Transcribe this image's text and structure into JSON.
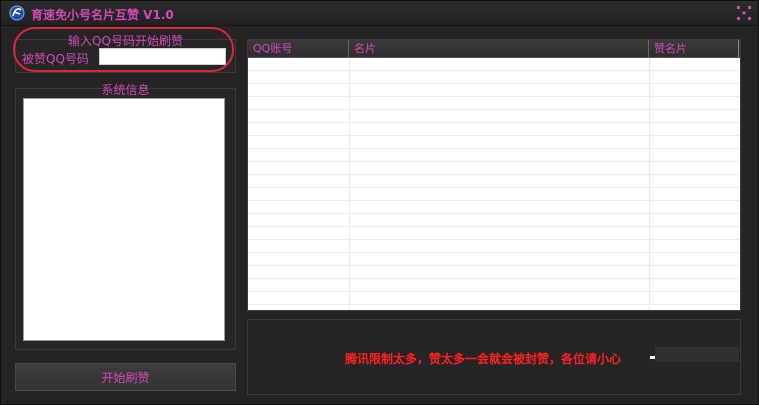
{
  "window": {
    "title": "育速免小号名片互赞 V1.0",
    "icons": {
      "app": "app-logo-icon",
      "close": "close-icon"
    }
  },
  "input_group": {
    "title": "输入QQ号码开始刷赞",
    "label": "被赞QQ号码",
    "value": "",
    "placeholder": ""
  },
  "sysinfo": {
    "title": "系统信息",
    "content": ""
  },
  "start_button": {
    "label": "开始刷赞"
  },
  "table": {
    "columns": [
      "QQ账号",
      "名片",
      "赞名片"
    ],
    "rows": []
  },
  "status": {
    "warning": "腾讯限制太多，赞太多一会就会被封赞，各位请小心"
  },
  "colors": {
    "accent": "#d24ab7",
    "warning": "#ff2020",
    "highlight": "#d9273b",
    "background": "#242424"
  }
}
